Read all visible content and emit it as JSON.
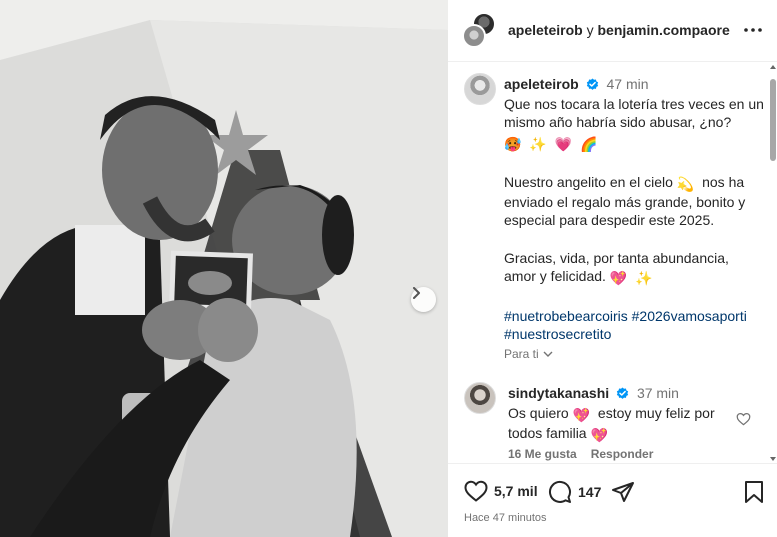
{
  "header": {
    "user1": "apeleteirob",
    "conjunction": "y",
    "user2": "benjamin.compaore",
    "more_icon": "more-horizontal-icon"
  },
  "photo": {
    "description_icon": "post-photo",
    "next_icon": "chevron-right-icon"
  },
  "caption": {
    "username": "apeleteirob",
    "verified_icon": "verified-badge-icon",
    "time": "47 min",
    "line1": "Que nos tocara la lotería tres veces en un mismo año habría sido abusar, ¿no?",
    "line1_emojis": [
      "🥵",
      "✨",
      "💗",
      "🌈"
    ],
    "p2_a": "Nuestro angelito en el cielo",
    "p2_emoji": "💫",
    "p2_b": "nos ha enviado el regalo más grande, bonito y especial para despedir este 2025.",
    "p3": "Gracias, vida, por tanta abundancia, amor y felicidad.",
    "p3_emojis": [
      "💖",
      "✨"
    ],
    "hashtag1": "#nuetrobebearcoiris",
    "hashtag2": "#2026vamosaporti",
    "hashtag3": "#nuestrosecretito"
  },
  "see_translation": "Para ti",
  "comment": {
    "username": "sindytakanashi",
    "time": "37 min",
    "text_a": "Os quiero",
    "emoji_a": "💖",
    "text_b": "estoy muy feliz por todos familia",
    "emoji_b": "💖",
    "likes": "16 Me gusta",
    "reply": "Responder"
  },
  "actions": {
    "likes": "5,7 mil",
    "comments": "147",
    "posted": "Hace 47 minutos"
  },
  "colors": {
    "text": "#262626",
    "muted": "#737373",
    "hashtag": "#00376b",
    "verified": "#0095f6"
  }
}
